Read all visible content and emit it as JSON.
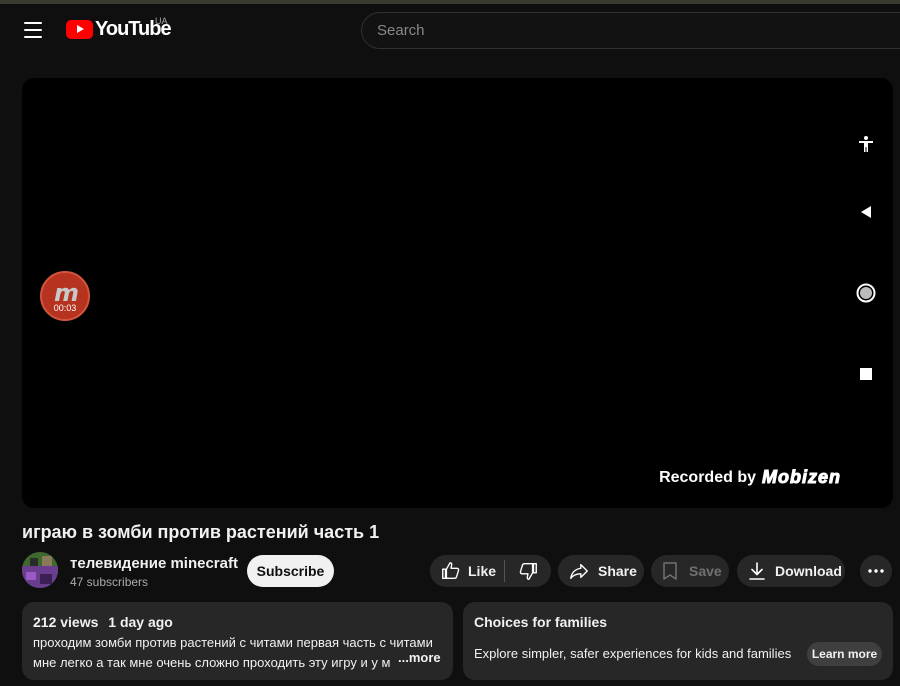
{
  "header": {
    "logo_text": "YouTube",
    "country_code": "UA",
    "search_placeholder": "Search"
  },
  "player": {
    "recorder_time": "00:03",
    "recorder_letter": "m",
    "watermark_prefix": "Recorded by",
    "watermark_brand": "Mobizen"
  },
  "video": {
    "title": "играю в зомби против растений часть 1"
  },
  "channel": {
    "name": "телевидение minecraft",
    "subscribers": "47 subscribers",
    "subscribe_label": "Subscribe"
  },
  "actions": {
    "like_label": "Like",
    "share_label": "Share",
    "save_label": "Save",
    "download_label": "Download"
  },
  "description": {
    "views": "212 views",
    "date": "1 day ago",
    "line1": "проходим зомби против растений с читами первая часть с читами",
    "line2": "мне легко а так мне очень сложно проходить эту игру и у м",
    "more_label": "...more"
  },
  "families": {
    "title": "Choices for families",
    "text": "Explore simpler, safer experiences for kids and families",
    "button_label": "Learn more"
  },
  "colors": {
    "background": "#0f0f0f",
    "brand_red": "#ff0000",
    "pill": "#272727"
  }
}
